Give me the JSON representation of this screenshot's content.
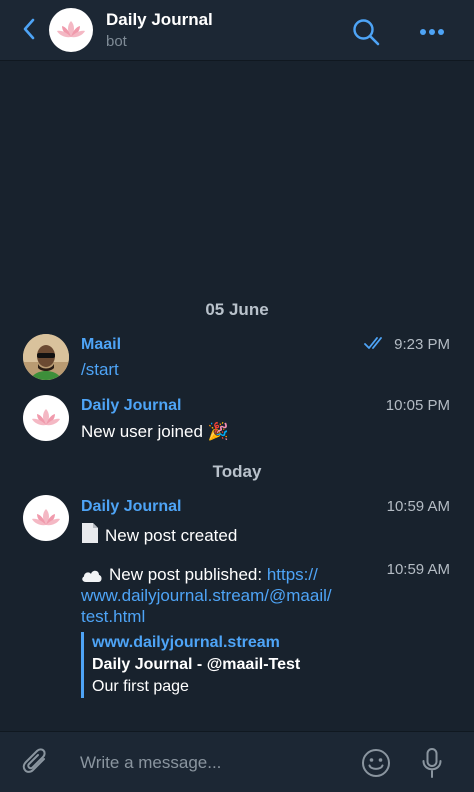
{
  "header": {
    "title": "Daily Journal",
    "subtitle": "bot",
    "icons": {
      "back": "chevron-left-icon",
      "avatar": "lotus-icon",
      "search": "search-icon",
      "more": "more-dots-icon"
    }
  },
  "dates": {
    "first": "05 June",
    "second": "Today"
  },
  "messages": [
    {
      "sender": "Maail",
      "text": "/start",
      "time": "9:23 PM",
      "status": "double-check-icon"
    },
    {
      "sender": "Daily Journal",
      "text": "New user joined",
      "emoji": "🎉",
      "time": "10:05 PM"
    },
    {
      "sender": "Daily Journal",
      "text": "New post created",
      "icon": "document-icon",
      "time": "10:59 AM"
    },
    {
      "text_prefix": "New post published:",
      "link": "https://www.dailyjournal.stream/@maail/test.html",
      "link_line1": "https://",
      "link_line2": "www.dailyjournal.stream/@maail/",
      "link_line3": "test.html",
      "icon": "cloud-icon",
      "time": "10:59 AM",
      "preview": {
        "site": "www.dailyjournal.stream",
        "title": "Daily Journal - @maail-Test",
        "description": "Our first page"
      }
    }
  ],
  "composer": {
    "placeholder": "Write a message...",
    "icons": {
      "attach": "paperclip-icon",
      "emoji": "smiley-icon",
      "mic": "microphone-icon"
    }
  },
  "colors": {
    "background": "#18222d",
    "header": "#1c2734",
    "accent": "#4ea4f6",
    "secondary_text": "#7f8b96"
  }
}
